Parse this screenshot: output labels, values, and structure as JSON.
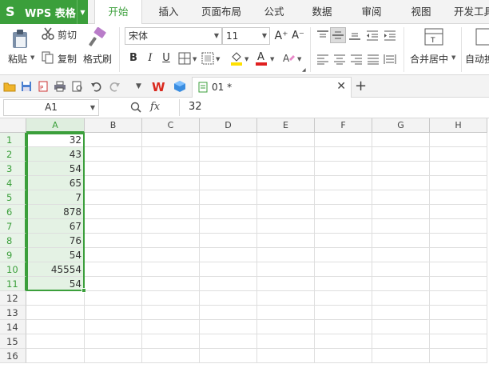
{
  "app": {
    "name": "WPS 表格",
    "logo": "S"
  },
  "menu_tabs": [
    {
      "label": "开始",
      "active": true
    },
    {
      "label": "插入"
    },
    {
      "label": "页面布局"
    },
    {
      "label": "公式"
    },
    {
      "label": "数据"
    },
    {
      "label": "审阅"
    },
    {
      "label": "视图"
    },
    {
      "label": "开发工具"
    }
  ],
  "ribbon": {
    "paste_label": "粘贴",
    "cut_label": "剪切",
    "copy_label": "复制",
    "format_painter_label": "格式刷",
    "font_name": "宋体",
    "font_size": "11",
    "bold": "B",
    "italic": "I",
    "underline": "U",
    "increase_font": "A⁺",
    "decrease_font": "A⁻",
    "merge_label": "合并居中",
    "wrap_label": "自动换行",
    "font_color": "#e02020",
    "fill_color": "#ffe000"
  },
  "doc_tab": {
    "name": "01 *"
  },
  "formula_bar": {
    "cell_ref": "A1",
    "fx": "fx",
    "value": "32"
  },
  "grid": {
    "columns": [
      "A",
      "B",
      "C",
      "D",
      "E",
      "F",
      "G",
      "H"
    ],
    "rows": [
      "1",
      "2",
      "3",
      "4",
      "5",
      "6",
      "7",
      "8",
      "9",
      "10",
      "11",
      "12",
      "13",
      "14",
      "15",
      "16"
    ],
    "column_a_values": [
      "32",
      "43",
      "54",
      "65",
      "7",
      "878",
      "67",
      "76",
      "54",
      "45554",
      "54"
    ]
  },
  "colors": {
    "accent": "#3b9f3b",
    "selection": "#e4f2e4"
  }
}
